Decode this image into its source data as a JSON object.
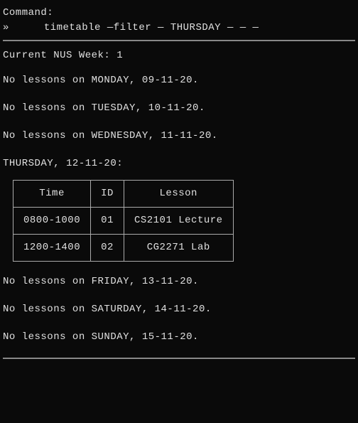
{
  "command": {
    "label": "Command:",
    "prompt": "»",
    "text": "timetable —filter — THURSDAY — — —"
  },
  "week_line": "Current NUS Week: 1",
  "messages": {
    "mon": "No lessons on MONDAY, 09-11-20.",
    "tue": "No lessons on TUESDAY, 10-11-20.",
    "wed": "No lessons on WEDNESDAY, 11-11-20.",
    "fri": "No lessons on FRIDAY, 13-11-20.",
    "sat": "No lessons on SATURDAY, 14-11-20.",
    "sun": "No lessons on SUNDAY, 15-11-20."
  },
  "thursday": {
    "header": "THURSDAY, 12-11-20:",
    "columns": {
      "time": "Time",
      "id": "ID",
      "lesson": "Lesson"
    },
    "rows": [
      {
        "time": "0800-1000",
        "id": "01",
        "lesson": "CS2101 Lecture"
      },
      {
        "time": "1200-1400",
        "id": "02",
        "lesson": "CG2271 Lab"
      }
    ]
  }
}
